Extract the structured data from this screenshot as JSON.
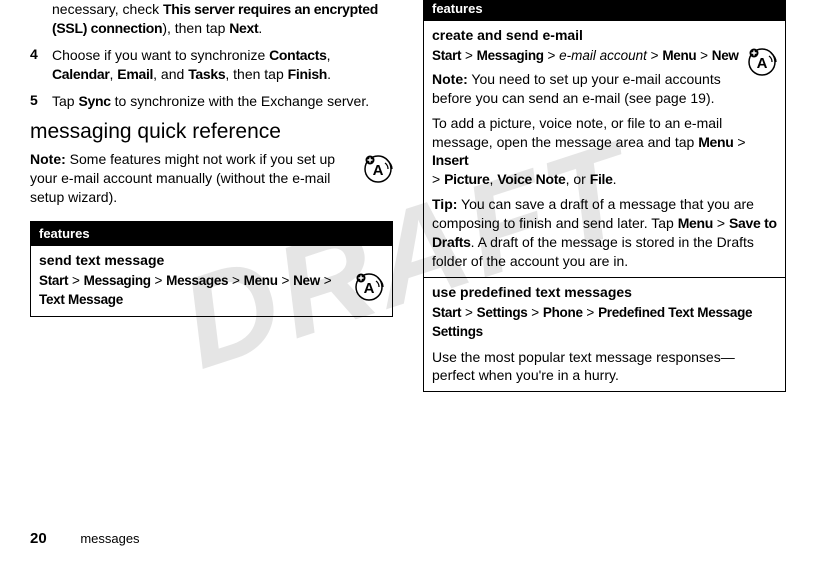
{
  "watermark": "DRAFT",
  "col1": {
    "ssl_fragment_pre": "necessary, check ",
    "ssl_bold": "This server requires an encrypted (SSL) connection",
    "ssl_fragment_post": "), then tap ",
    "next": "Next",
    "step4_num": "4",
    "step4_a": "Choose if you want to synchronize ",
    "contacts": "Contacts",
    "calendar": "Calendar",
    "email": "Email",
    "step4_b": ", and ",
    "tasks": "Tasks",
    "step4_c": ", then tap ",
    "finish": "Finish",
    "step5_num": "5",
    "step5_a": "Tap ",
    "sync": "Sync",
    "step5_b": " to synchronize with the Exchange server.",
    "section": "messaging quick reference",
    "note": "Note:",
    "note_body": " Some features might not work if you set up your e-mail account manually (without the e-mail setup wizard).",
    "features_header": "features",
    "feat_send_title": "send text message",
    "start": "Start",
    "messaging": "Messaging",
    "messages": "Messages",
    "menu": "Menu",
    "new": "New",
    "text_message": "Text Message"
  },
  "col2": {
    "features_header": "features",
    "feat_email_title": "create and send e-mail",
    "start": "Start",
    "messaging": "Messaging",
    "email_account": "e-mail account",
    "menu": "Menu",
    "new": "New",
    "note": "Note:",
    "note_body": " You need to set up your e-mail accounts before you can send an e-mail (see page 19).",
    "attach_a": "To add a picture, voice note, or file to an e-mail message, open the message area and tap ",
    "insert": "Insert",
    "picture": "Picture",
    "voice_note": "Voice Note",
    "or": ", or ",
    "file": "File",
    "tip": "Tip:",
    "tip_body_a": " You can save a draft of a message that you are composing to finish and send later. Tap ",
    "save_drafts": "Save to Drafts",
    "tip_body_b": ". A draft of the message is stored in the Drafts folder of the account you are in.",
    "feat_predef_title": "use predefined text messages",
    "settings": "Settings",
    "phone": "Phone",
    "predef": "Predefined Text Message Settings",
    "predef_desc": "Use the most popular text message responses—perfect when you're in a hurry."
  },
  "footer": {
    "page": "20",
    "section": "messages"
  }
}
